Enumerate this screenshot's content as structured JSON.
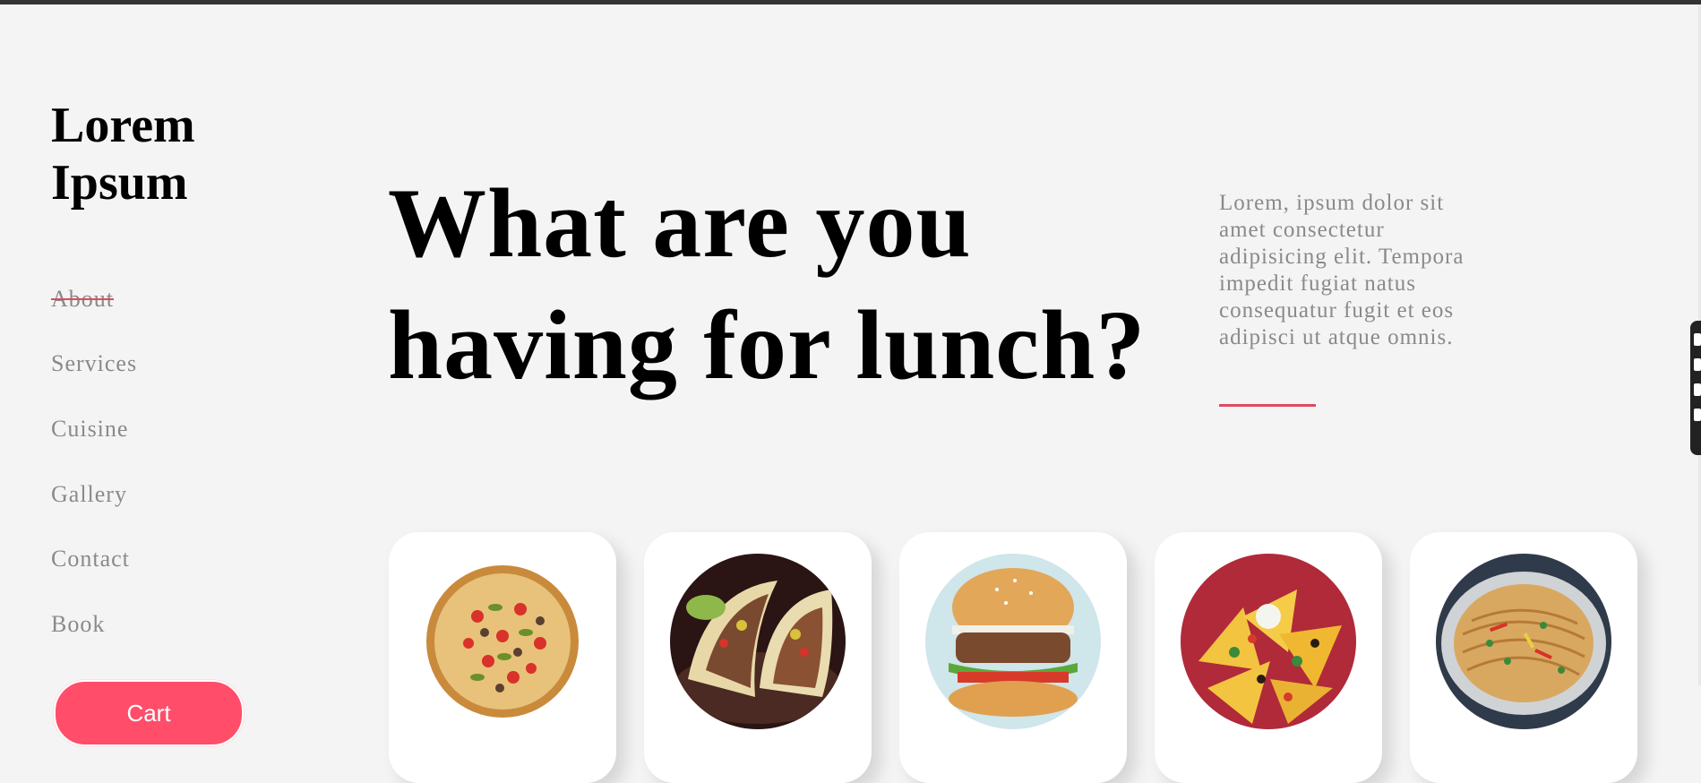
{
  "brand": {
    "name": "Lorem Ipsum"
  },
  "nav": {
    "items": [
      {
        "label": "About",
        "active": true
      },
      {
        "label": "Services"
      },
      {
        "label": "Cuisine"
      },
      {
        "label": "Gallery"
      },
      {
        "label": "Contact"
      },
      {
        "label": "Book"
      }
    ],
    "cart_label": "Cart"
  },
  "hero": {
    "title": "What are you having for lunch?",
    "description": "Lorem, ipsum dolor sit amet consectetur adipisicing elit. Tempora impedit fugiat natus consequatur fugit et eos adipisci ut atque omnis."
  },
  "dishes": [
    {
      "name": "pizza-icon"
    },
    {
      "name": "tacos-icon"
    },
    {
      "name": "burger-icon"
    },
    {
      "name": "nachos-icon"
    },
    {
      "name": "noodles-icon"
    }
  ],
  "colors": {
    "background": "#f4f4f4",
    "accent": "#ff4d6a",
    "underline": "#e04a5f",
    "muted_text": "#8a8a8a"
  }
}
